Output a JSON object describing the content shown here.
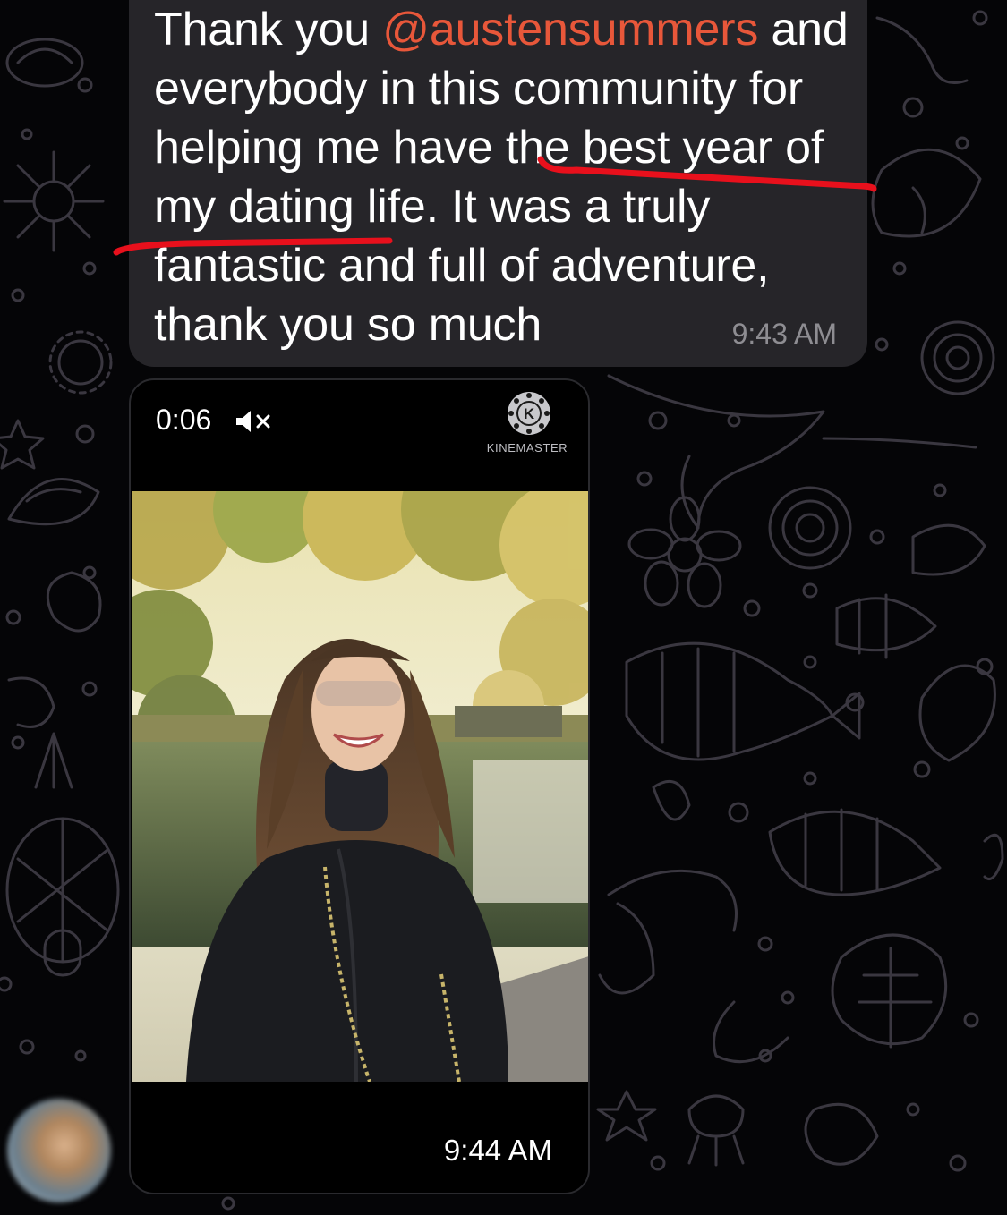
{
  "messages": {
    "text_message": {
      "prefix": "Thank you ",
      "mention": "@austensummers",
      "body": " and everybody in this community for helping me have the best year of my dating life. It was a truly fantastic and full of adventure, thank you so much",
      "time": "9:43 AM"
    },
    "video_message": {
      "duration": "0:06",
      "muted_icon": "speaker-muted-icon",
      "watermark": "KINEMASTER",
      "watermark_icon": "kinemaster-k-icon",
      "time": "9:44 AM"
    }
  },
  "colors": {
    "bubble_background": "#262529",
    "mention": "#e8573a",
    "annotation": "#e8101c",
    "timestamp": "#8e8d92",
    "wallpaper_lines": "#3a3740"
  }
}
